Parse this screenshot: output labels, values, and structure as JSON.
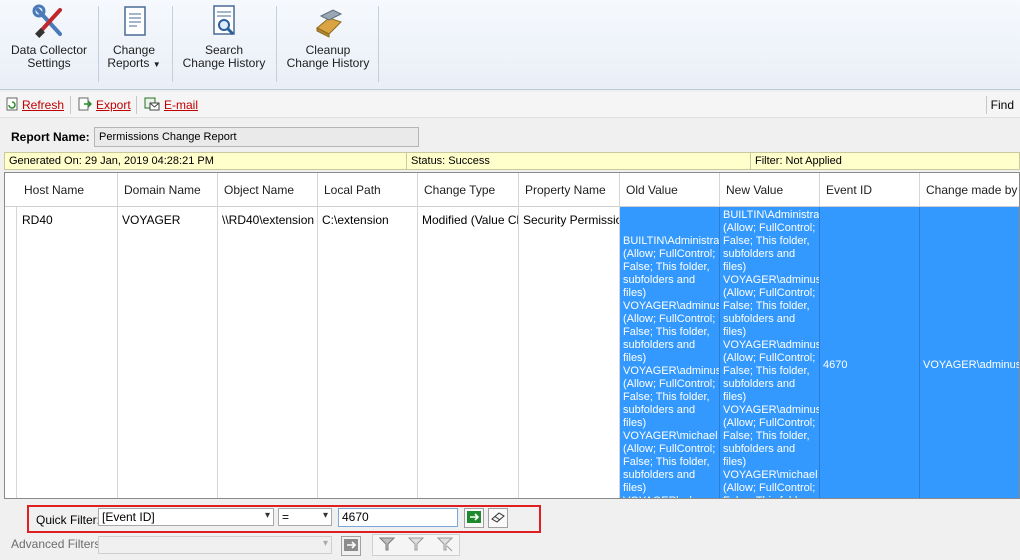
{
  "ribbon": {
    "buttons": [
      {
        "line1": "Data Collector",
        "line2": "Settings",
        "icon": "tools-icon"
      },
      {
        "line1": "Change",
        "line2": "Reports",
        "icon": "report-document-icon"
      },
      {
        "line1": "Search",
        "line2": "Change History",
        "icon": "search-document-icon"
      },
      {
        "line1": "Cleanup",
        "line2": "Change History",
        "icon": "eraser-icon"
      }
    ]
  },
  "toolbar": {
    "refresh": "Refresh",
    "export": "Export",
    "email": "E-mail",
    "find": "Find"
  },
  "report": {
    "name_label": "Report Name:",
    "name_value": "Permissions Change Report"
  },
  "status": {
    "generated": "Generated On: 29 Jan, 2019 04:28:21 PM",
    "status": "Status: Success",
    "filter": "Filter: Not Applied"
  },
  "grid": {
    "columns": [
      "Host Name",
      "Domain Name",
      "Object Name",
      "Local Path",
      "Change Type",
      "Property Name",
      "Old Value",
      "New Value",
      "Event ID",
      "Change made by"
    ],
    "row": {
      "host": "RD40",
      "domain": "VOYAGER",
      "object": "\\\\RD40\\extension",
      "path": "C:\\extension",
      "change_type": "Modified (Value Cha",
      "property": "Security Permissions",
      "old_value": "BUILTIN\\Administrat (Allow; FullControl; False; This folder, subfolders and files) VOYAGER\\adminus (Allow; FullControl; False; This folder, subfolders and files) VOYAGER\\adminus (Allow; FullControl; False; This folder, subfolders and files) VOYAGER\\michael (Allow; FullControl; False; This folder, subfolders and files) VOYAGER\\adm",
      "new_value": "BUILTIN\\Administrat (Allow; FullControl; False; This folder, subfolders and files) VOYAGER\\adminus (Allow; FullControl; False; This folder, subfolders and files) VOYAGER\\adminus (Allow; FullControl; False; This folder, subfolders and files) VOYAGER\\adminus (Allow; FullControl; False; This folder, subfolders and files) VOYAGER\\michael (Allow; FullControl; False; This folder, subfolders and files)",
      "event_id": "4670",
      "changed_by": "VOYAGER\\adminus"
    }
  },
  "quick_filter": {
    "label": "Quick Filter:",
    "field": "[Event ID]",
    "operator": "=",
    "value": "4670"
  },
  "advanced_filter": {
    "label": "Advanced Filters:"
  },
  "colors": {
    "selection": "#3399ff",
    "status_bg": "#ffffcc",
    "highlight_border": "#e02020",
    "link": "#c00000"
  }
}
